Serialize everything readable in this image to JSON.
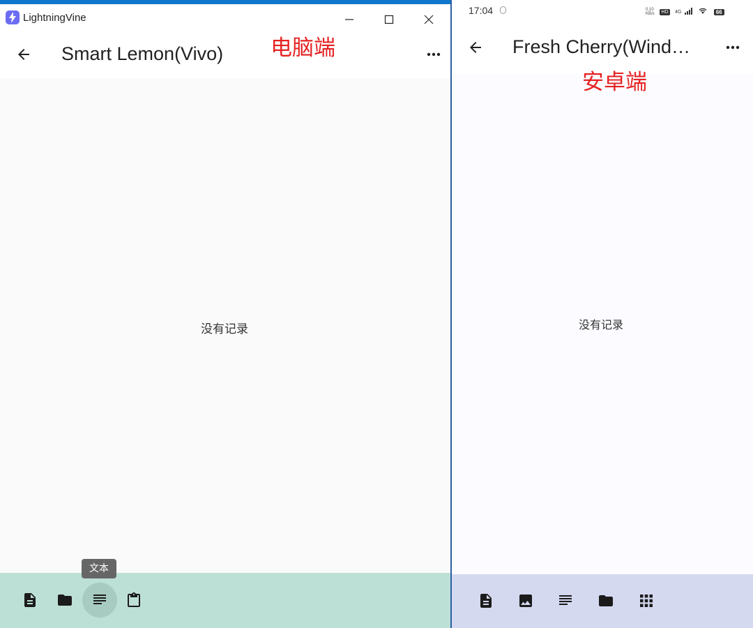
{
  "desktop": {
    "app_name": "LightningVine",
    "title": "Smart Lemon(Vivo)",
    "annotation": "电脑端",
    "empty_message": "没有记录",
    "tooltip": "文本",
    "bottom_bar": {
      "icons": [
        "file-document-icon",
        "folder-icon",
        "text-lines-icon",
        "clipboard-icon"
      ],
      "active": "text-lines-icon"
    },
    "colors": {
      "bottom_bar": "#bde0d6",
      "title_accent": "#1177cc",
      "annotation": "#e52222"
    }
  },
  "mobile": {
    "status_time": "17:04",
    "status_speed": "0.10 KB/s",
    "status_hd": "HD",
    "status_network": "4G",
    "battery": "66",
    "title": "Fresh Cherry(Wind…",
    "annotation": "安卓端",
    "empty_message": "没有记录",
    "bottom_bar": {
      "icons": [
        "file-document-icon",
        "image-icon",
        "text-lines-icon",
        "folder-icon",
        "apps-grid-icon"
      ]
    },
    "colors": {
      "bottom_bar": "#d5d9f0"
    }
  }
}
